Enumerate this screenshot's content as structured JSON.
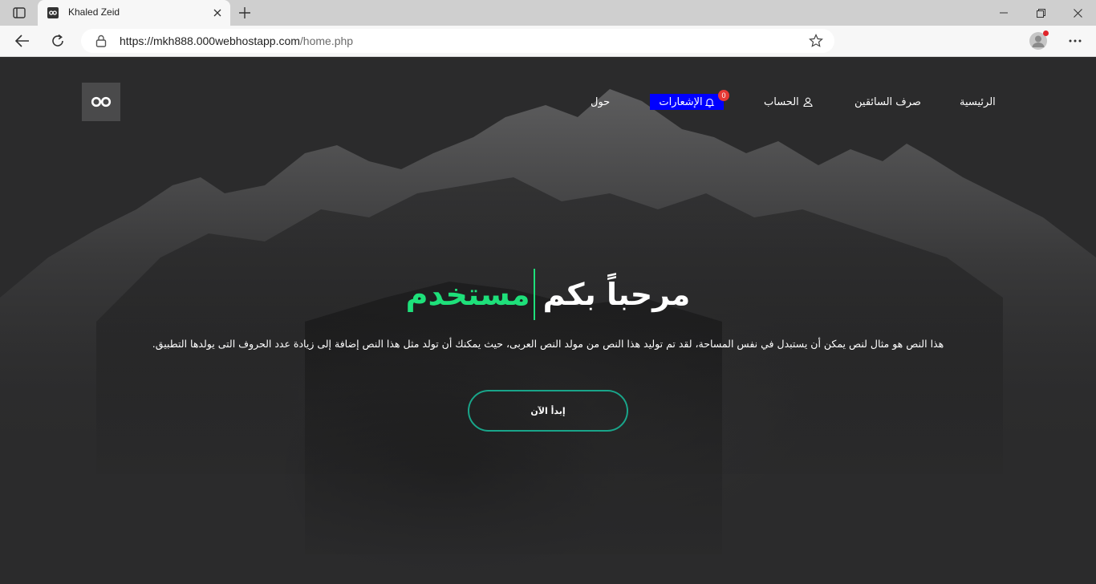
{
  "browser": {
    "tab_title": "Khaled Zeid",
    "url_host": "https://mkh888.000webhostapp.com",
    "url_path": "/home.php"
  },
  "nav": {
    "home": "الرئيسية",
    "drivers_exchange": "صرف السائقين",
    "account": "الحساب",
    "notifications": "الإشعارات",
    "notifications_count": "0",
    "about": "حول"
  },
  "hero": {
    "welcome": "مرحباً بكم",
    "typed_word": "مستخدم",
    "description": "هذا النص هو مثال لنص يمكن أن يستبدل في نفس المساحة، لقد تم توليد هذا النص من مولد النص العربى، حيث يمكنك أن تولد مثل هذا النص إضافة إلى زيادة عدد الحروف التى يولدها التطبيق.",
    "cta_label": "إبدأ الآن"
  },
  "colors": {
    "accent_green": "#1ee07a",
    "button_border": "#19a58a",
    "notif_bg": "#0000ff",
    "badge": "#e53935"
  },
  "icons": {
    "logo": "infinity-icon",
    "account": "user-icon",
    "notifications": "bell-icon"
  }
}
